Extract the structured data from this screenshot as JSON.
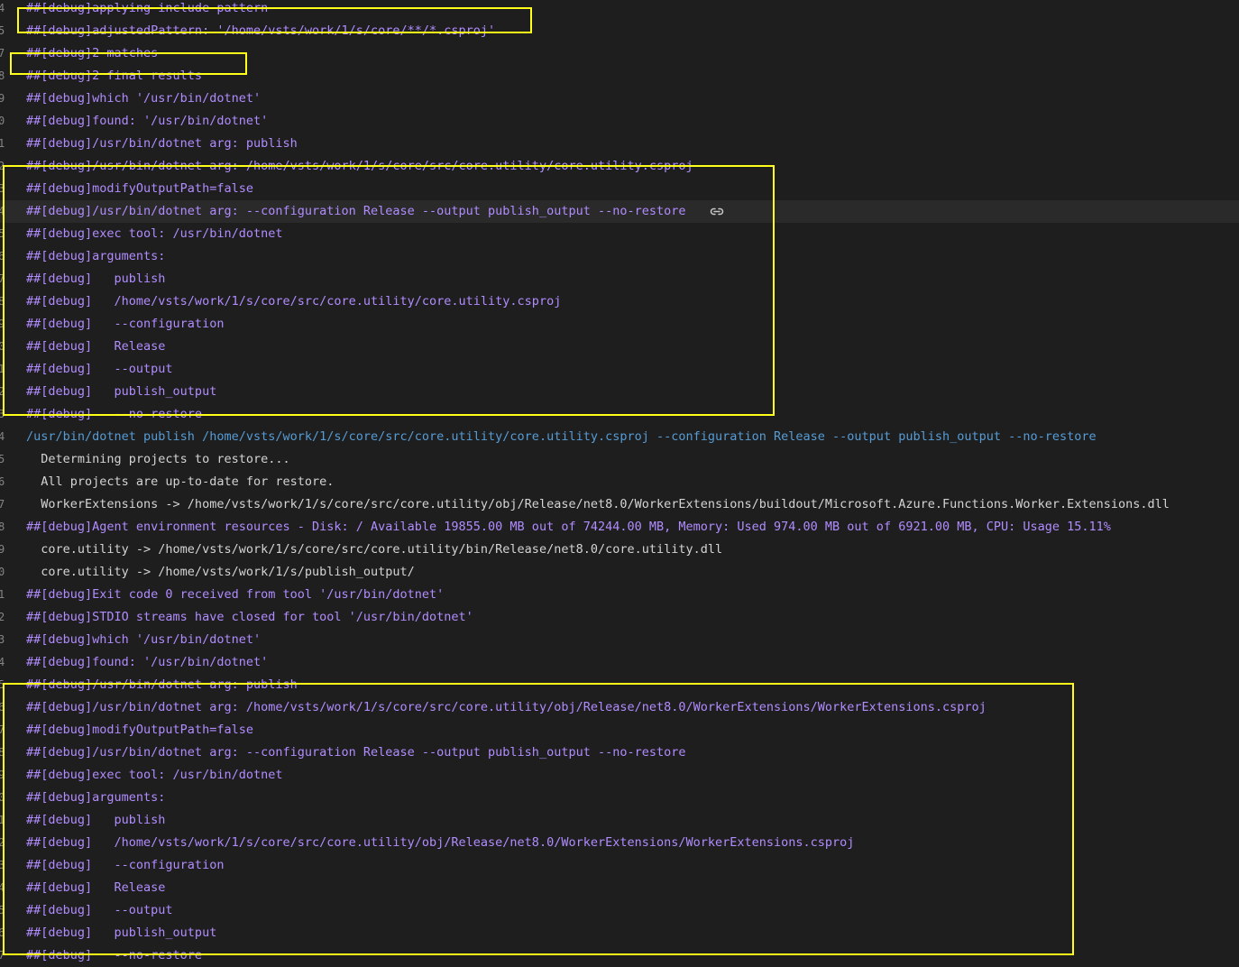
{
  "colors": {
    "debug": "#b18cff",
    "command": "#569cd6",
    "output": "#d4d4d4",
    "highlight": "#ffff19",
    "background": "#1e1e1e"
  },
  "icons": {
    "copy_link": "link-icon"
  },
  "lines": [
    {
      "n": "4",
      "text": "##[debug]applying include pattern",
      "kind": "dbg"
    },
    {
      "n": "5",
      "text": "##[debug]adjustedPattern: '/home/vsts/work/1/s/core/**/*.csproj'",
      "kind": "dbg"
    },
    {
      "n": "7",
      "text": "##[debug]2 matches",
      "kind": "dbg"
    },
    {
      "n": "8",
      "text": "##[debug]2 final results",
      "kind": "dbg"
    },
    {
      "n": "9",
      "text": "##[debug]which '/usr/bin/dotnet'",
      "kind": "dbg"
    },
    {
      "n": "0",
      "text": "##[debug]found: '/usr/bin/dotnet'",
      "kind": "dbg"
    },
    {
      "n": "1",
      "text": "##[debug]/usr/bin/dotnet arg: publish",
      "kind": "dbg"
    },
    {
      "n": "2",
      "text": "##[debug]/usr/bin/dotnet arg: /home/vsts/work/1/s/core/src/core.utility/core.utility.csproj",
      "kind": "dbg"
    },
    {
      "n": "3",
      "text": "##[debug]modifyOutputPath=false",
      "kind": "dbg"
    },
    {
      "n": "4",
      "text": "##[debug]/usr/bin/dotnet arg: --configuration Release --output publish_output --no-restore",
      "kind": "dbg",
      "hover": true
    },
    {
      "n": "5",
      "text": "##[debug]exec tool: /usr/bin/dotnet",
      "kind": "dbg"
    },
    {
      "n": "6",
      "text": "##[debug]arguments:",
      "kind": "dbg"
    },
    {
      "n": "7",
      "text": "##[debug]   publish",
      "kind": "dbg"
    },
    {
      "n": "8",
      "text": "##[debug]   /home/vsts/work/1/s/core/src/core.utility/core.utility.csproj",
      "kind": "dbg"
    },
    {
      "n": "9",
      "text": "##[debug]   --configuration",
      "kind": "dbg"
    },
    {
      "n": "0",
      "text": "##[debug]   Release",
      "kind": "dbg"
    },
    {
      "n": "1",
      "text": "##[debug]   --output",
      "kind": "dbg"
    },
    {
      "n": "2",
      "text": "##[debug]   publish_output",
      "kind": "dbg"
    },
    {
      "n": "3",
      "text": "##[debug]   --no-restore",
      "kind": "dbg"
    },
    {
      "n": "4",
      "text": "/usr/bin/dotnet publish /home/vsts/work/1/s/core/src/core.utility/core.utility.csproj --configuration Release --output publish_output --no-restore",
      "kind": "cmd"
    },
    {
      "n": "5",
      "text": "  Determining projects to restore...",
      "kind": "out"
    },
    {
      "n": "6",
      "text": "  All projects are up-to-date for restore.",
      "kind": "out"
    },
    {
      "n": "7",
      "text": "  WorkerExtensions -> /home/vsts/work/1/s/core/src/core.utility/obj/Release/net8.0/WorkerExtensions/buildout/Microsoft.Azure.Functions.Worker.Extensions.dll",
      "kind": "out"
    },
    {
      "n": "8",
      "text": "##[debug]Agent environment resources - Disk: / Available 19855.00 MB out of 74244.00 MB, Memory: Used 974.00 MB out of 6921.00 MB, CPU: Usage 15.11%",
      "kind": "dbg"
    },
    {
      "n": "9",
      "text": "  core.utility -> /home/vsts/work/1/s/core/src/core.utility/bin/Release/net8.0/core.utility.dll",
      "kind": "out"
    },
    {
      "n": "0",
      "text": "  core.utility -> /home/vsts/work/1/s/publish_output/",
      "kind": "out"
    },
    {
      "n": "1",
      "text": "##[debug]Exit code 0 received from tool '/usr/bin/dotnet'",
      "kind": "dbg"
    },
    {
      "n": "2",
      "text": "##[debug]STDIO streams have closed for tool '/usr/bin/dotnet'",
      "kind": "dbg"
    },
    {
      "n": "3",
      "text": "##[debug]which '/usr/bin/dotnet'",
      "kind": "dbg"
    },
    {
      "n": "4",
      "text": "##[debug]found: '/usr/bin/dotnet'",
      "kind": "dbg"
    },
    {
      "n": "5",
      "text": "##[debug]/usr/bin/dotnet arg: publish",
      "kind": "dbg"
    },
    {
      "n": "6",
      "text": "##[debug]/usr/bin/dotnet arg: /home/vsts/work/1/s/core/src/core.utility/obj/Release/net8.0/WorkerExtensions/WorkerExtensions.csproj",
      "kind": "dbg"
    },
    {
      "n": "7",
      "text": "##[debug]modifyOutputPath=false",
      "kind": "dbg"
    },
    {
      "n": "8",
      "text": "##[debug]/usr/bin/dotnet arg: --configuration Release --output publish_output --no-restore",
      "kind": "dbg"
    },
    {
      "n": "9",
      "text": "##[debug]exec tool: /usr/bin/dotnet",
      "kind": "dbg"
    },
    {
      "n": "0",
      "text": "##[debug]arguments:",
      "kind": "dbg"
    },
    {
      "n": "1",
      "text": "##[debug]   publish",
      "kind": "dbg"
    },
    {
      "n": "2",
      "text": "##[debug]   /home/vsts/work/1/s/core/src/core.utility/obj/Release/net8.0/WorkerExtensions/WorkerExtensions.csproj",
      "kind": "dbg"
    },
    {
      "n": "3",
      "text": "##[debug]   --configuration",
      "kind": "dbg"
    },
    {
      "n": "4",
      "text": "##[debug]   Release",
      "kind": "dbg"
    },
    {
      "n": "5",
      "text": "##[debug]   --output",
      "kind": "dbg"
    },
    {
      "n": "6",
      "text": "##[debug]   publish_output",
      "kind": "dbg"
    },
    {
      "n": "7",
      "text": "##[debug]   --no-restore",
      "kind": "dbg"
    }
  ]
}
